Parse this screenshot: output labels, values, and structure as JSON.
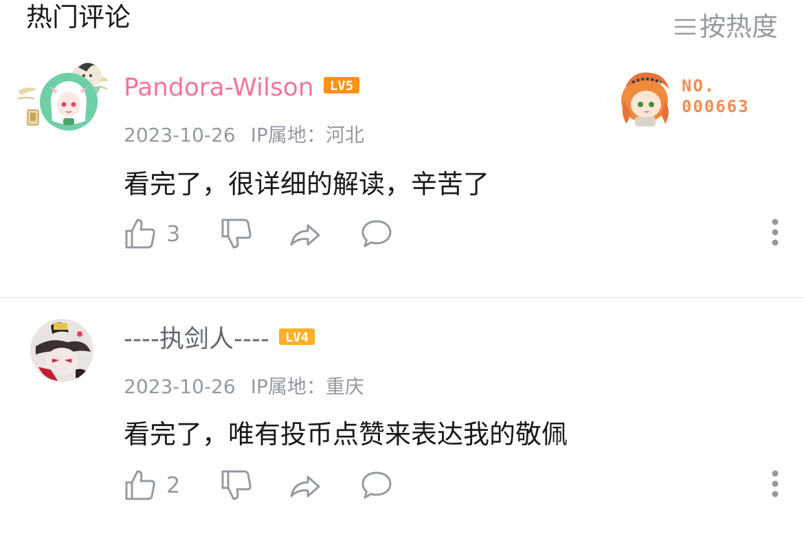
{
  "header": {
    "title": "热门评论",
    "sort_label": "按热度"
  },
  "comments": [
    {
      "username": "Pandora-Wilson",
      "username_color": "#fb7299",
      "level": "LV5",
      "level_color": "#ff9212",
      "date": "2023-10-26",
      "ip_label": "IP属地：河北",
      "content": "看完了，很详细的解读，辛苦了",
      "likes": "3",
      "fan_badge": {
        "line1": "NO.",
        "line2": "000663",
        "color": "#f28c52"
      }
    },
    {
      "username": "----执剑人----",
      "username_color": "#61666d",
      "level": "LV4",
      "level_color": "#ffb027",
      "date": "2023-10-26",
      "ip_label": "IP属地：重庆",
      "content": "看完了，唯有投币点赞来表达我的敬佩",
      "likes": "2"
    }
  ],
  "colors": {
    "text_primary": "#18191c",
    "text_secondary": "#9499a0",
    "divider": "#eeeff1"
  }
}
